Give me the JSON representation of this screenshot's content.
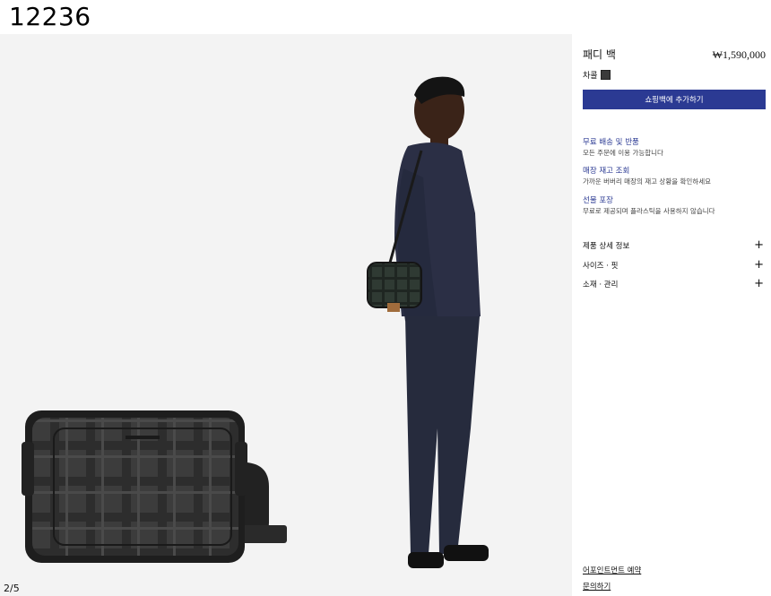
{
  "page": {
    "id_text": "12236"
  },
  "gallery": {
    "pager": "2/5"
  },
  "product": {
    "name": "패디 백",
    "price": "₩1,590,000",
    "color_label": "차콜",
    "add_to_bag": "쇼핑백에 추가하기"
  },
  "services": [
    {
      "title": "무료 배송 및 반품",
      "desc": "모든 주문에 이용 가능합니다"
    },
    {
      "title": "매장 재고 조회",
      "desc": "가까운 버버리 매장의 재고 상황을 확인하세요"
    },
    {
      "title": "선물 포장",
      "desc": "무료로 제공되며 플라스틱을 사용하지 않습니다"
    }
  ],
  "accordions": [
    {
      "label": "제품 상세 정보",
      "icon": "plus-icon"
    },
    {
      "label": "사이즈 · 핏",
      "icon": "plus-icon"
    },
    {
      "label": "소재 · 관리",
      "icon": "plus-icon"
    }
  ],
  "footer_links": {
    "appointment": "어포인트먼트 예약",
    "contact": "문의하기"
  },
  "colors": {
    "accent": "#2b3a93",
    "gallery_bg": "#f3f3f3",
    "swatch": "#3b3b3b"
  }
}
